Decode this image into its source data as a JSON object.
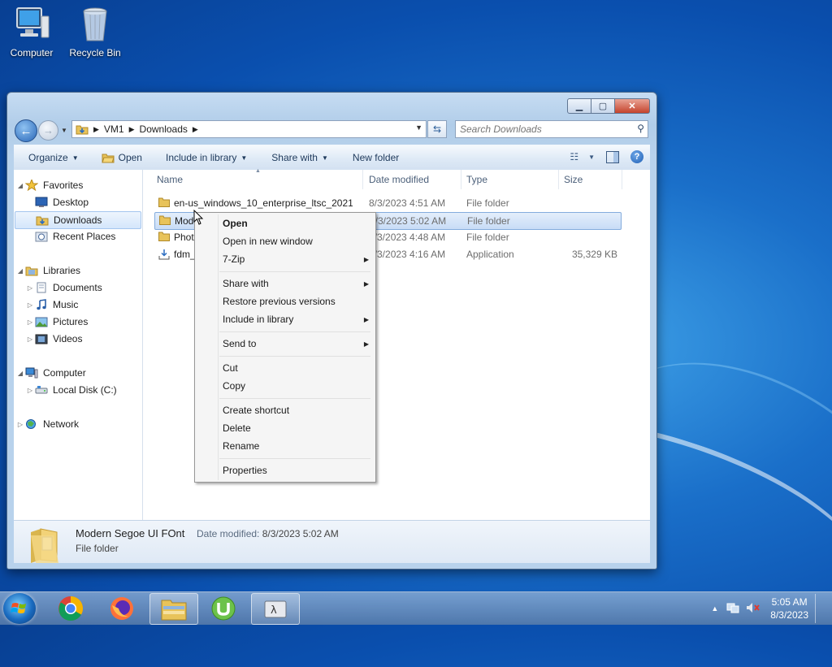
{
  "desktop": {
    "icons": [
      {
        "label": "Computer",
        "icon": "computer-icon"
      },
      {
        "label": "Recycle Bin",
        "icon": "recycle-bin-icon"
      }
    ]
  },
  "window": {
    "address": [
      "VM1",
      "Downloads"
    ],
    "search_placeholder": "Search Downloads",
    "toolbar": {
      "organize": "Organize",
      "open": "Open",
      "include": "Include in library",
      "share": "Share with",
      "new_folder": "New folder"
    },
    "nav": {
      "favorites": "Favorites",
      "desktop": "Desktop",
      "downloads": "Downloads",
      "recent": "Recent Places",
      "libraries": "Libraries",
      "documents": "Documents",
      "music": "Music",
      "pictures": "Pictures",
      "videos": "Videos",
      "computer": "Computer",
      "local_disk": "Local Disk (C:)",
      "network": "Network"
    },
    "columns": {
      "name": "Name",
      "date": "Date modified",
      "type": "Type",
      "size": "Size"
    },
    "files": [
      {
        "name": "en-us_windows_10_enterprise_ltsc_2021_...",
        "date": "8/3/2023 4:51 AM",
        "type": "File folder",
        "size": "",
        "icon": "folder-icon"
      },
      {
        "name": "Mod",
        "date": "8/3/2023 5:02 AM",
        "type": "File folder",
        "size": "",
        "icon": "folder-icon"
      },
      {
        "name": "Phot",
        "date": "8/3/2023 4:48 AM",
        "type": "File folder",
        "size": "",
        "icon": "folder-icon"
      },
      {
        "name": "fdm_",
        "date": "8/3/2023 4:16 AM",
        "type": "Application",
        "size": "35,329 KB",
        "icon": "installer-icon"
      }
    ],
    "details": {
      "name": "Modern Segoe UI FOnt",
      "date_label": "Date modified:",
      "date": "8/3/2023 5:02 AM",
      "type": "File folder"
    }
  },
  "context_menu": {
    "open": "Open",
    "open_new_window": "Open in new window",
    "seven_zip": "7-Zip",
    "share_with": "Share with",
    "restore": "Restore previous versions",
    "include": "Include in library",
    "send_to": "Send to",
    "cut": "Cut",
    "copy": "Copy",
    "create_shortcut": "Create shortcut",
    "delete": "Delete",
    "rename": "Rename",
    "properties": "Properties"
  },
  "taskbar": {
    "apps": [
      "chrome-icon",
      "firefox-icon",
      "explorer-icon",
      "utorrent-icon",
      "terminal-icon"
    ],
    "time": "5:05 AM",
    "date": "8/3/2023"
  }
}
